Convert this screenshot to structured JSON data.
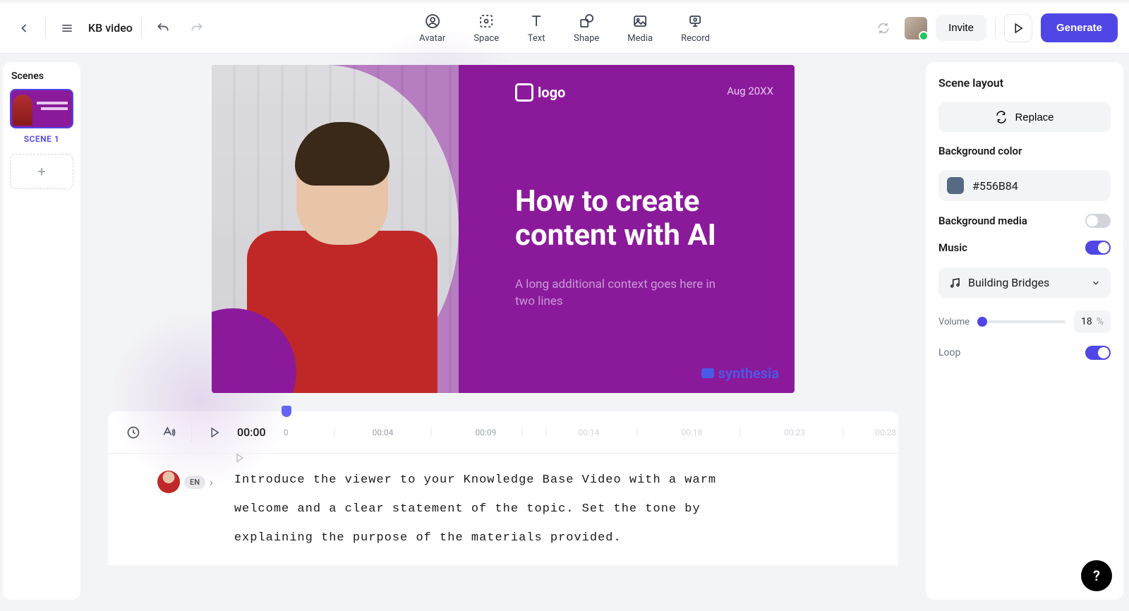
{
  "header": {
    "project_title": "KB video",
    "tools": {
      "avatar": "Avatar",
      "space": "Space",
      "text": "Text",
      "shape": "Shape",
      "media": "Media",
      "record": "Record"
    },
    "invite": "Invite",
    "generate": "Generate"
  },
  "scenes": {
    "title": "Scenes",
    "items": [
      {
        "label": "SCENE 1"
      }
    ]
  },
  "canvas": {
    "logo": "logo",
    "date": "Aug 20XX",
    "headline": "How to create content with AI",
    "subline": "A long additional context goes here in two lines",
    "brand": "synthesia"
  },
  "timeline": {
    "current": "00:00",
    "ticks": [
      "0",
      "00:04",
      "00:09",
      "00:14",
      "00:18",
      "00:23",
      "00:28"
    ],
    "lang": "EN",
    "script": "Introduce the viewer to your Knowledge Base Video with a warm welcome and a clear statement of the topic. Set the tone by explaining the purpose of the materials provided."
  },
  "inspector": {
    "scene_layout": "Scene layout",
    "replace": "Replace",
    "bg_color_label": "Background color",
    "bg_color_value": "#556B84",
    "bg_media_label": "Background media",
    "bg_media_on": false,
    "music_label": "Music",
    "music_on": true,
    "music_track": "Building Bridges",
    "volume_label": "Volume",
    "volume_value": "18",
    "volume_unit": "%",
    "volume_pct": 18,
    "loop_label": "Loop",
    "loop_on": true
  },
  "help": "?"
}
